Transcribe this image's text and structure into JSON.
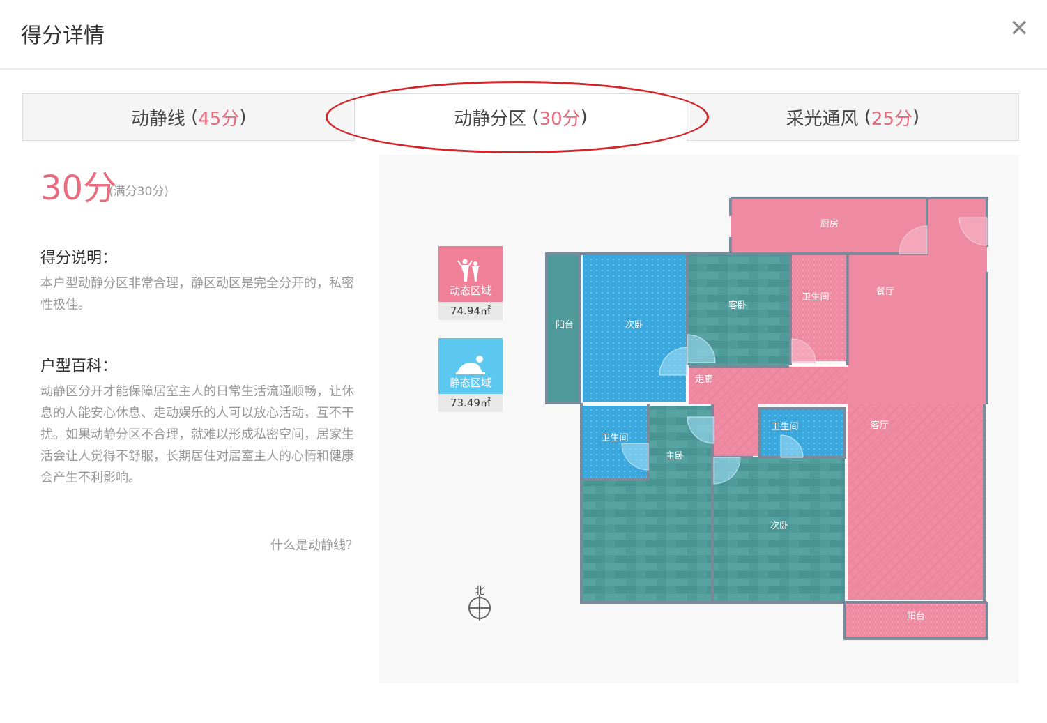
{
  "dialog": {
    "title": "得分详情",
    "close_symbol": "✕"
  },
  "tabs": [
    {
      "label": "动静线",
      "score": "45分"
    },
    {
      "label": "动静分区",
      "score": "30分"
    },
    {
      "label": "采光通风",
      "score": "25分"
    }
  ],
  "active_tab": 1,
  "summary": {
    "score": "30分",
    "full_score": "(满分30分)"
  },
  "explanation": {
    "heading": "得分说明：",
    "text": "本户型动静分区非常合理，静区动区是完全分开的，私密性极佳。"
  },
  "encyclopedia": {
    "heading": "户型百科：",
    "text": "动静区分开才能保障居室主人的日常生活流通顺畅，让休息的人能安心休息、走动娱乐的人可以放心活动，互不干扰。如果动静分区不合理，就难以形成私密空间，居家生活会让人觉得不舒服，长期居住对居室主人的心情和健康会产生不利影响。"
  },
  "help_link": "什么是动静线？",
  "legend": {
    "dynamic": {
      "label": "动态区域",
      "area": "74.94㎡",
      "color": "#f07f98",
      "icon": "people-icon"
    },
    "static": {
      "label": "静态区域",
      "area": "73.49㎡",
      "color": "#5cc8f0",
      "icon": "sleeping-icon"
    }
  },
  "compass": {
    "label": "北",
    "icon": "compass-icon"
  },
  "floorplan": {
    "rooms": {
      "kitchen": "厨房",
      "dining": "餐厅",
      "bath1": "卫生间",
      "living_small": "客卧",
      "bedroom2": "次卧",
      "balcony_left": "阳台",
      "corridor": "走廊",
      "bath2": "卫生间",
      "bath3": "卫生间",
      "master": "主卧",
      "bedroom3": "次卧",
      "living": "客厅",
      "balcony_bottom": "阳台"
    },
    "colors": {
      "dynamic": "#ef8aa3",
      "static_teal": "#4f9a9a",
      "static_blue": "#3aa8dd",
      "wall": "#7a8a9a"
    }
  }
}
